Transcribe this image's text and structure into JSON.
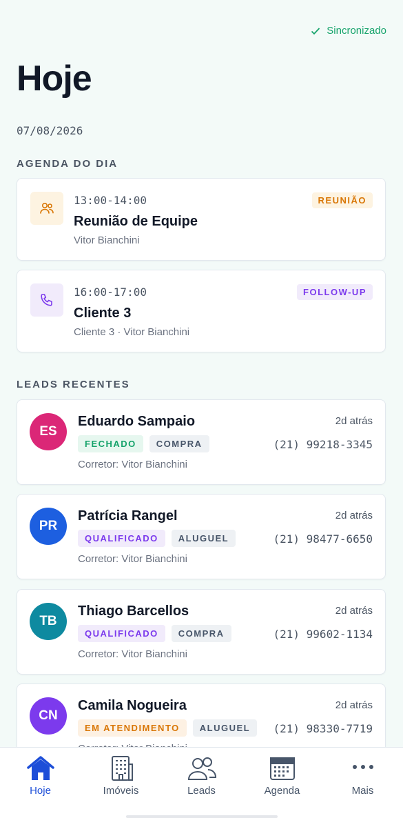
{
  "sync": {
    "label": "Sincronizado",
    "icon": "check-icon",
    "color": "#16a36b"
  },
  "page": {
    "title": "Hoje",
    "date": "07/08/2026"
  },
  "agenda": {
    "label": "AGENDA DO DIA",
    "items": [
      {
        "time": "13:00-14:00",
        "title": "Reunião de Equipe",
        "subtitle": "Vitor Bianchini",
        "tag": "REUNIÃO",
        "icon": "users-icon"
      },
      {
        "time": "16:00-17:00",
        "title": "Cliente 3",
        "subtitle": "Cliente 3 · Vitor Bianchini",
        "tag": "FOLLOW-UP",
        "icon": "phone-icon"
      }
    ]
  },
  "leads": {
    "label": "LEADS RECENTES",
    "items": [
      {
        "initials": "ES",
        "name": "Eduardo Sampaio",
        "time": "2d atrás",
        "status": "FECHADO",
        "type": "COMPRA",
        "phone": "(21) 99218-3345",
        "broker": "Corretor: Vitor Bianchini",
        "avatar_color": "#db2777"
      },
      {
        "initials": "PR",
        "name": "Patrícia Rangel",
        "time": "2d atrás",
        "status": "QUALIFICADO",
        "type": "ALUGUEL",
        "phone": "(21) 98477-6650",
        "broker": "Corretor: Vitor Bianchini",
        "avatar_color": "#1d5fe0"
      },
      {
        "initials": "TB",
        "name": "Thiago Barcellos",
        "time": "2d atrás",
        "status": "QUALIFICADO",
        "type": "COMPRA",
        "phone": "(21) 99602-1134",
        "broker": "Corretor: Vitor Bianchini",
        "avatar_color": "#0e8aa0"
      },
      {
        "initials": "CN",
        "name": "Camila Nogueira",
        "time": "2d atrás",
        "status": "EM ATENDIMENTO",
        "type": "ALUGUEL",
        "phone": "(21) 98330-7719",
        "broker": "Corretor: Vitor Bianchini",
        "avatar_color": "#7c3aed"
      }
    ]
  },
  "nav": {
    "items": [
      {
        "label": "Hoje",
        "icon": "home-icon",
        "active": true
      },
      {
        "label": "Imóveis",
        "icon": "building-icon"
      },
      {
        "label": "Leads",
        "icon": "users-icon"
      },
      {
        "label": "Agenda",
        "icon": "calendar-icon"
      },
      {
        "label": "Mais",
        "icon": "more-icon"
      }
    ]
  },
  "colors": {
    "accent": "#1d4ed8",
    "meeting_tag_bg": "#fdf3e1",
    "meeting_tag_fg": "#d97706",
    "followup_tag_bg": "#f1ebfb",
    "followup_tag_fg": "#7c3aed",
    "closed_bg": "#e6f7ef",
    "closed_fg": "#16a36b",
    "qualified_bg": "#f1ebfb",
    "qualified_fg": "#7c3aed",
    "attending_bg": "#fdf1e3",
    "attending_fg": "#d97706",
    "type_bg": "#eef1f4",
    "type_fg": "#475569"
  }
}
